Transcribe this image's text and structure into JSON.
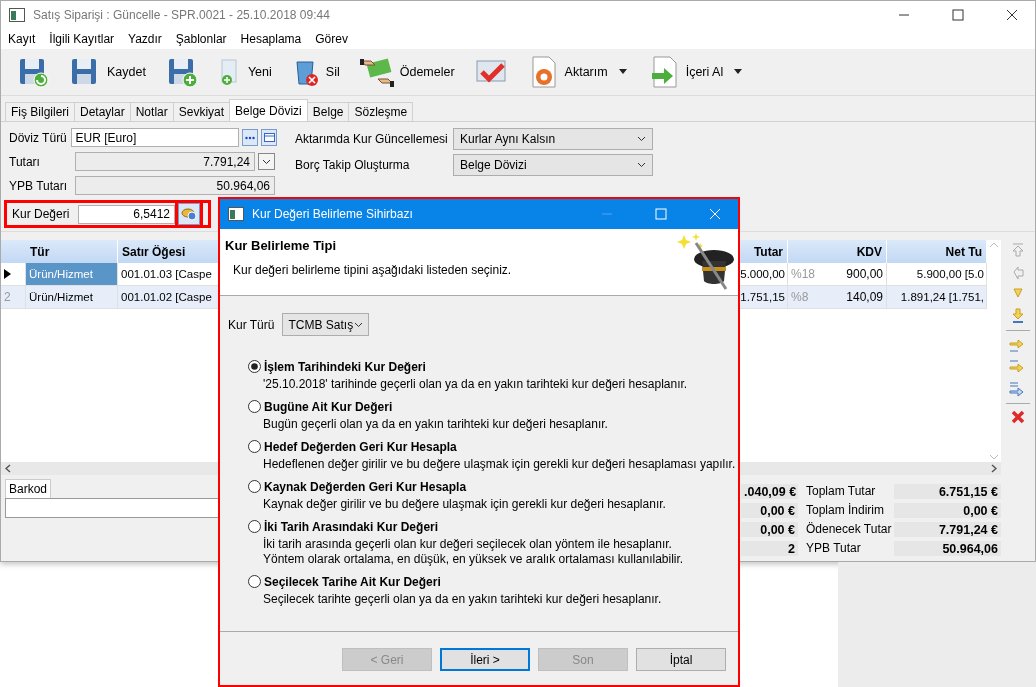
{
  "window": {
    "title": "Satış Siparişi : Güncelle - SPR.0021 - 25.10.2018 09:44"
  },
  "menu": [
    "Kayıt",
    "İlgili Kayıtlar",
    "Yazdır",
    "Şablonlar",
    "Hesaplama",
    "Görev"
  ],
  "toolbar": [
    {
      "kind": "save-refresh",
      "dropdown": false
    },
    {
      "kind": "save",
      "label": "Kaydet",
      "dropdown": false
    },
    {
      "kind": "save-add",
      "dropdown": false
    },
    {
      "kind": "new",
      "label": "Yeni",
      "dropdown": false
    },
    {
      "kind": "delete",
      "label": "Sil",
      "dropdown": false
    },
    {
      "kind": "money",
      "label": "Ödemeler",
      "dropdown": false
    },
    {
      "kind": "approve",
      "dropdown": false
    },
    {
      "kind": "export",
      "label": "Aktarım",
      "dropdown": true
    },
    {
      "kind": "import",
      "label": "İçeri Al",
      "dropdown": true
    }
  ],
  "tabs": [
    {
      "label": "Fiş Bilgileri",
      "selected": false
    },
    {
      "label": "Detaylar",
      "selected": false
    },
    {
      "label": "Notlar",
      "selected": false
    },
    {
      "label": "Sevkiyat",
      "selected": false
    },
    {
      "label": "Belge Dövizi",
      "selected": true
    },
    {
      "label": "Belge",
      "selected": false
    },
    {
      "label": "Sözleşme",
      "selected": false
    }
  ],
  "form": {
    "fields": [
      {
        "kind": "lookup",
        "label": "Döviz Türü",
        "value": "EUR [Euro]",
        "highlighted": false
      },
      {
        "kind": "dropdown",
        "label": "Tutarı",
        "value": "7.791,24",
        "highlighted": false
      },
      {
        "kind": "readonly",
        "label": "YPB Tutarı",
        "value": "50.964,06",
        "highlighted": false
      },
      {
        "kind": "rate",
        "label": "Kur Değeri",
        "value": "6,5412",
        "highlighted": true
      }
    ],
    "selects": [
      {
        "label": "Aktarımda Kur Güncellemesi",
        "value": "Kurlar Aynı Kalsın"
      },
      {
        "label": "Borç Takip Oluşturma",
        "value": "Belge Dövizi"
      }
    ]
  },
  "grid": {
    "columns": [
      "Tür",
      "Satır Öğesi",
      "Tutar",
      "KDV",
      "Net Tu"
    ],
    "rows": [
      {
        "current": true,
        "number": "",
        "type": "Ürün/Hizmet",
        "item": "001.01.03 [Caspe",
        "amount": "5.000,00",
        "vat_rate": "%18",
        "vat": "900,00",
        "net": "5.900,00 [5.0"
      },
      {
        "current": false,
        "number": "2",
        "type": "Ürün/Hizmet",
        "item": "001.01.02 [Caspe",
        "amount": "1.751,15",
        "vat_rate": "%8",
        "vat": "140,09",
        "net": "1.891,24 [1.751,"
      }
    ]
  },
  "barcode": {
    "tab": "Barkod"
  },
  "totals": [
    {
      "left_value": ".040,09 €",
      "label": "Toplam Tutar",
      "value": "6.751,15 €"
    },
    {
      "left_value": "0,00 €",
      "label": "Toplam İndirim",
      "value": "0,00 €"
    },
    {
      "left_value": "0,00 €",
      "label": "Ödenecek Tutar",
      "value": "7.791,24 €"
    },
    {
      "left_value": "2",
      "label": "YPB Tutar",
      "value": "50.964,06"
    }
  ],
  "dialog": {
    "title": "Kur Değeri Belirleme Sihirbazı",
    "heading": "Kur Belirleme Tipi",
    "subtitle": "Kur değeri belirleme tipini aşağıdaki listeden seçiniz.",
    "rate_type": {
      "label": "Kur Türü",
      "value": "TCMB Satış"
    },
    "options": [
      {
        "label": "İşlem Tarihindeki Kur Değeri",
        "description": "'25.10.2018' tarihinde geçerli olan ya da en yakın tarihteki kur değeri hesaplanır.",
        "selected": true
      },
      {
        "label": "Bugüne Ait Kur Değeri",
        "description": "Bugün geçerli olan ya da en yakın tarihteki kur değeri hesaplanır.",
        "selected": false
      },
      {
        "label": "Hedef Değerden Geri Kur Hesapla",
        "description": "Hedeflenen değer girilir ve bu değere ulaşmak için gerekli kur değeri hesaplaması yapılır.",
        "selected": false
      },
      {
        "label": "Kaynak Değerden Geri Kur Hesapla",
        "description": "Kaynak değer girilir ve bu değere ulaşmak için gerekli kur değeri hesaplanır.",
        "selected": false
      },
      {
        "label": "İki Tarih Arasındaki Kur Değeri",
        "description": "İki tarih arasında geçerli olan kur değeri seçilecek olan yöntem ile hesaplanır.\nYöntem olarak ortalama, en düşük, en yüksek ve aralık ortalaması kullanılabilir.",
        "selected": false
      },
      {
        "label": "Seçilecek Tarihe Ait Kur Değeri",
        "description": "Seçilecek tarihte geçerli olan ya da en yakın tarihteki kur değeri hesaplanır.",
        "selected": false
      }
    ],
    "buttons": [
      {
        "label": "< Geri",
        "disabled": true,
        "focused": false
      },
      {
        "label": "İleri >",
        "disabled": false,
        "focused": true
      },
      {
        "label": "Son",
        "disabled": true,
        "focused": false
      },
      {
        "label": "İptal",
        "disabled": false,
        "focused": false
      }
    ]
  }
}
